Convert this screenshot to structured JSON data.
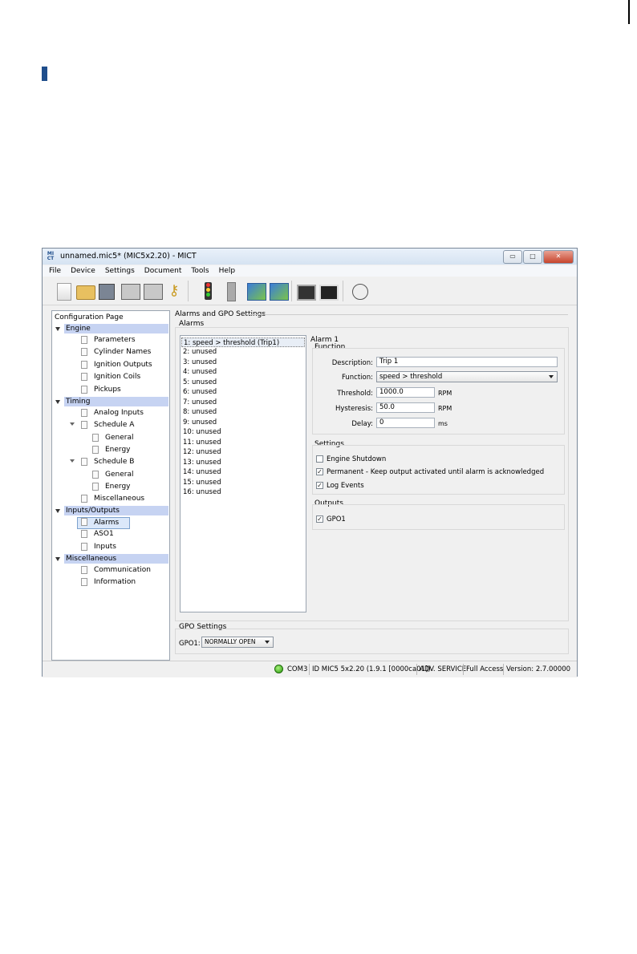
{
  "window": {
    "title": "unnamed.mic5* (MIC5x2.20) - MICT",
    "logo": "MI CT",
    "controls": {
      "minimize": "▭",
      "maximize": "□",
      "close": "✕"
    }
  },
  "menu": [
    "File",
    "Device",
    "Settings",
    "Document",
    "Tools",
    "Help"
  ],
  "toolbar_icons": [
    "new-file-icon",
    "open-folder-icon",
    "save-icon",
    "print-icon",
    "print-preview-icon",
    "key-icon",
    "traffic-light-icon",
    "device-icon",
    "network-connect-icon",
    "network-transfer-icon",
    "monitor-icon",
    "monitor-dark-icon",
    "gauge-icon"
  ],
  "config_tree": {
    "title": "Configuration Page",
    "sections": {
      "engine": {
        "label": "Engine",
        "items": [
          "Parameters",
          "Cylinder Names",
          "Ignition Outputs",
          "Ignition Coils",
          "Pickups"
        ]
      },
      "timing": {
        "label": "Timing",
        "analog": "Analog Inputs",
        "schedule_a": "Schedule A",
        "schedule_a_items": [
          "General",
          "Energy"
        ],
        "schedule_b": "Schedule B",
        "schedule_b_items": [
          "General",
          "Energy"
        ],
        "misc": "Miscellaneous"
      },
      "io": {
        "label": "Inputs/Outputs",
        "items": [
          "Alarms",
          "ASO1",
          "Inputs"
        ]
      },
      "misc": {
        "label": "Miscellaneous",
        "items": [
          "Communication",
          "Information"
        ]
      }
    }
  },
  "main": {
    "section_title": "Alarms and GPO Settings",
    "alarms_label": "Alarms",
    "alarm_list": [
      "1: speed > threshold (Trip1)",
      "2: unused",
      "3: unused",
      "4: unused",
      "5: unused",
      "6: unused",
      "7: unused",
      "8: unused",
      "9: unused",
      "10: unused",
      "11: unused",
      "12: unused",
      "13: unused",
      "14: unused",
      "15: unused",
      "16: unused"
    ],
    "alarm_title": "Alarm 1",
    "function_group": "Function",
    "fields": {
      "description_label": "Description:",
      "description_value": "Trip 1",
      "function_label": "Function:",
      "function_value": "speed > threshold",
      "threshold_label": "Threshold:",
      "threshold_value": "1000.0",
      "threshold_unit": "RPM",
      "hysteresis_label": "Hysteresis:",
      "hysteresis_value": "50.0",
      "hysteresis_unit": "RPM",
      "delay_label": "Delay:",
      "delay_value": "0",
      "delay_unit": "ms"
    },
    "settings_group": "Settings",
    "settings": {
      "engine_shutdown": {
        "label": "Engine Shutdown",
        "checked": ""
      },
      "permanent": {
        "label": "Permanent - Keep output activated until alarm is acknowledged",
        "checked": "✓"
      },
      "log_events": {
        "label": "Log Events",
        "checked": "✓"
      }
    },
    "outputs_group": "Outputs",
    "outputs": {
      "gpo1": {
        "label": "GPO1",
        "checked": "✓"
      }
    },
    "gpo_settings": {
      "title": "GPO Settings",
      "gpo1_label": "GPO1:",
      "gpo1_value": "NORMALLY OPEN"
    }
  },
  "status": {
    "led_color": "#3cba1a",
    "port": "COM3",
    "id": "ID MIC5 5x2.20 (1.9.1 [0000ca01])",
    "service": "ADV. SERVICE",
    "access": "Full Access",
    "version": "Version: 2.7.00000"
  }
}
